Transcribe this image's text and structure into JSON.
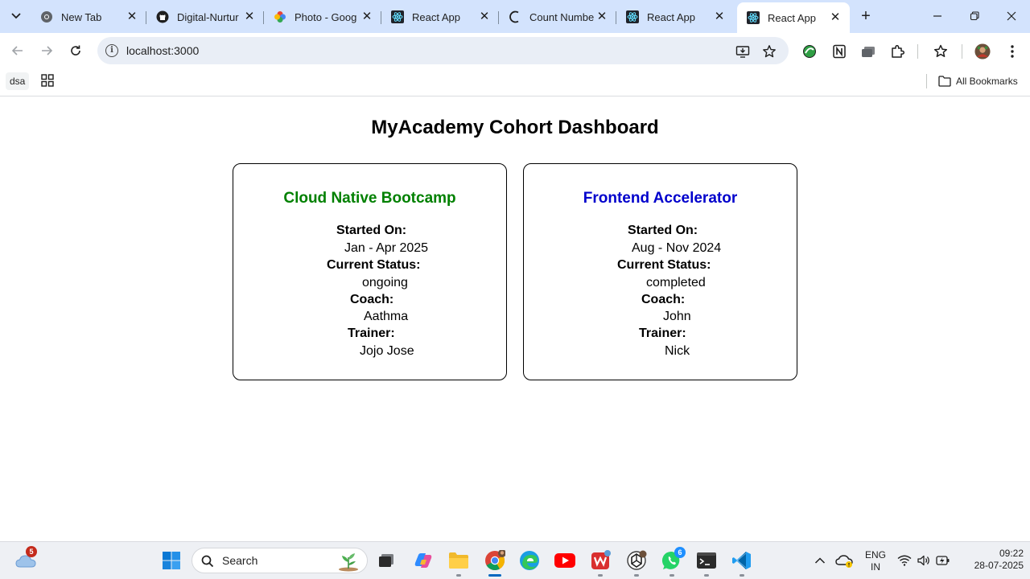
{
  "browser": {
    "tabs": [
      {
        "title": "New Tab",
        "icon": "chrome-icon",
        "active": false
      },
      {
        "title": "Digital-Nurtur",
        "icon": "github-icon",
        "active": false
      },
      {
        "title": "Photo - Goog",
        "icon": "google-photos-icon",
        "active": false
      },
      {
        "title": "React App",
        "icon": "react-icon",
        "active": false
      },
      {
        "title": "Count Numbe",
        "icon": "loading-icon",
        "active": false
      },
      {
        "title": "React App",
        "icon": "react-icon",
        "active": false
      },
      {
        "title": "React App",
        "icon": "react-icon",
        "active": true
      }
    ],
    "url": "localhost:3000",
    "bookmarks": {
      "chip": "dsa",
      "all_bookmarks": "All Bookmarks"
    }
  },
  "page": {
    "title": "MyAcademy Cohort Dashboard",
    "cohorts": [
      {
        "name": "Cloud Native Bootcamp",
        "color": "#008000",
        "started_label": "Started On:",
        "started": "Jan - Apr 2025",
        "status_label": "Current Status:",
        "status": "ongoing",
        "coach_label": "Coach:",
        "coach": "Aathma",
        "trainer_label": "Trainer:",
        "trainer": "Jojo Jose"
      },
      {
        "name": "Frontend Accelerator",
        "color": "#0000cc",
        "started_label": "Started On:",
        "started": "Aug - Nov 2024",
        "status_label": "Current Status:",
        "status": "completed",
        "coach_label": "Coach:",
        "coach": "John",
        "trainer_label": "Trainer:",
        "trainer": "Nick"
      }
    ]
  },
  "taskbar": {
    "weather_badge": "5",
    "search_placeholder": "Search",
    "whatsapp_badge": "6",
    "lang_line1": "ENG",
    "lang_line2": "IN",
    "time": "09:22",
    "date": "28-07-2025"
  }
}
